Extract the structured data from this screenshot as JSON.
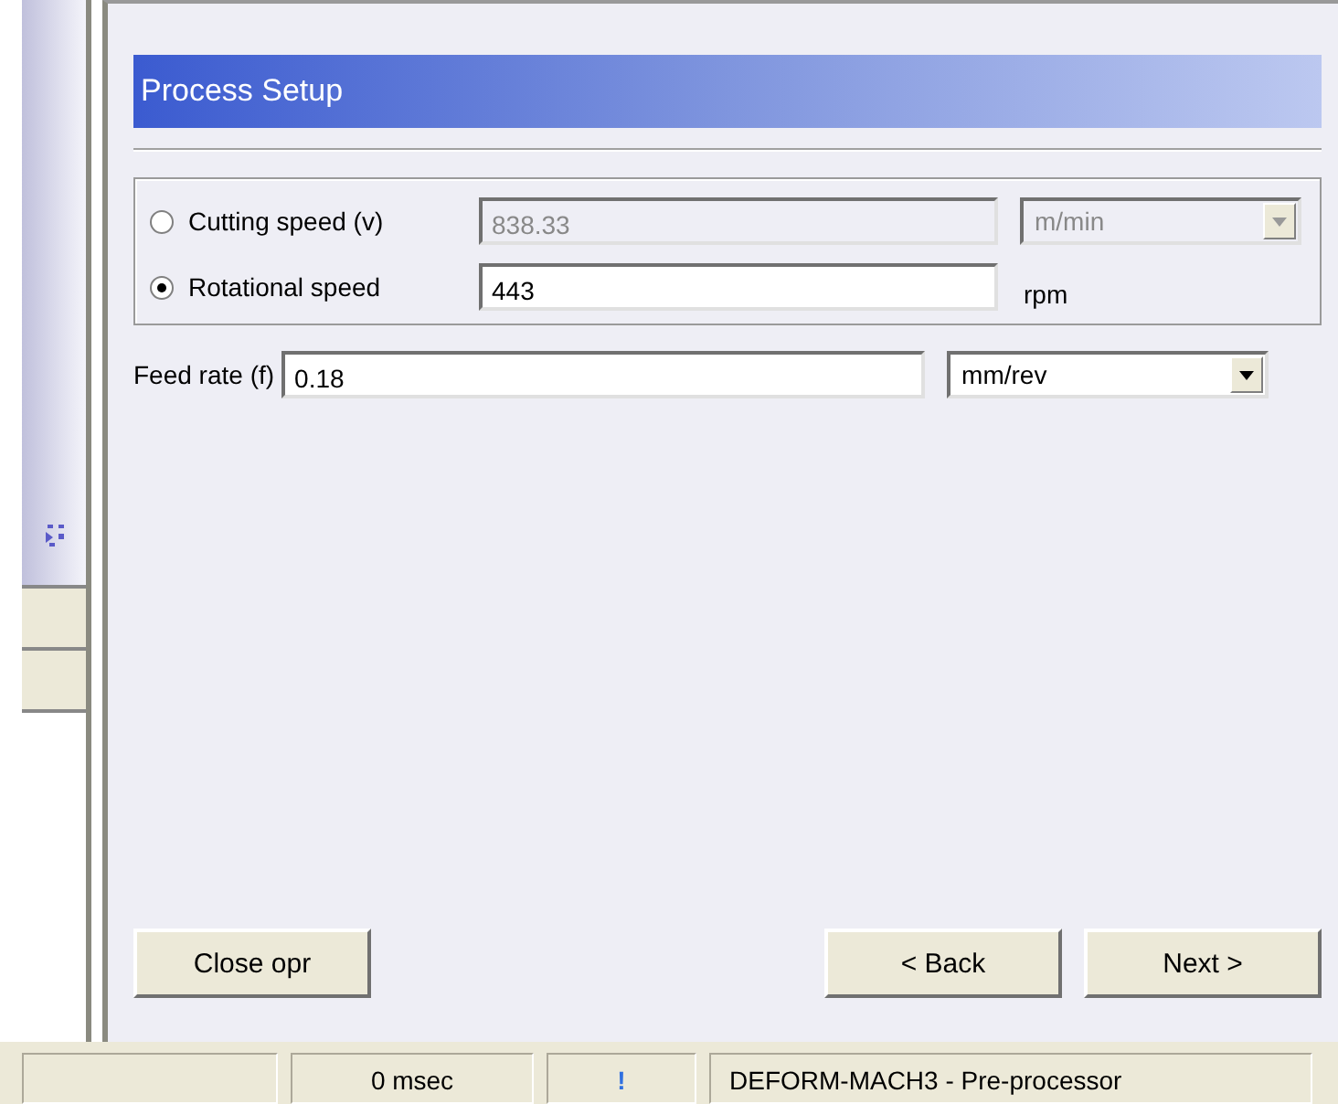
{
  "panel_title": "Process Setup",
  "speed_options": [
    {
      "label": "Cutting speed (v)",
      "selected": false,
      "value": "838.33",
      "unit": "m/min",
      "kind": "dropdown"
    },
    {
      "label": "Rotational speed",
      "selected": true,
      "value": "443",
      "unit": "rpm",
      "kind": "text"
    }
  ],
  "feed_rate": {
    "label": "Feed rate (f)",
    "value": "0.18",
    "unit": "mm/rev"
  },
  "buttons": {
    "left": [
      "Close opr"
    ],
    "right": [
      "< Back",
      "Next >"
    ]
  },
  "status_bar": [
    "0 msec",
    "!",
    "DEFORM-MACH3  -  Pre-processor"
  ]
}
